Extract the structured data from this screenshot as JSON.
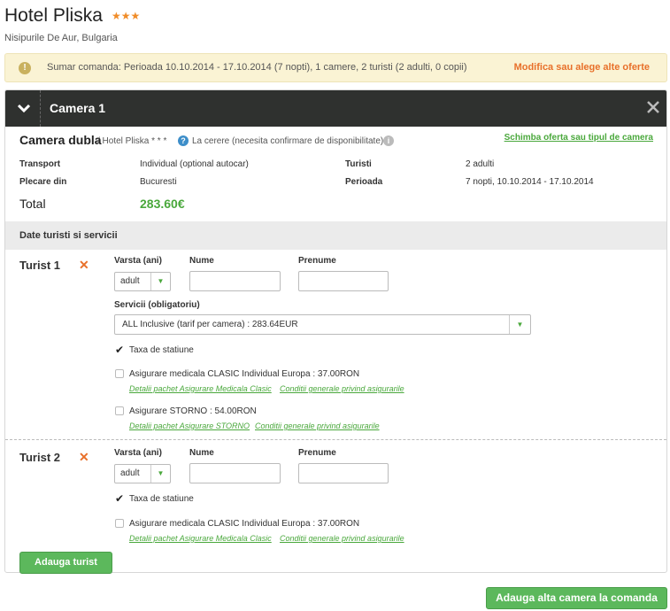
{
  "hotel": {
    "name": "Hotel Pliska",
    "stars": "★★★",
    "location": "Nisipurile De Aur, Bulgaria"
  },
  "summary": {
    "text": "Sumar comanda: Perioada 10.10.2014 - 17.10.2014 (7 nopti), 1 camere, 2 turisti (2 adulti, 0 copii)",
    "modify_link": "Modifica sau alege alte oferte"
  },
  "room": {
    "header_title": "Camera 1",
    "type": "Camera dubla",
    "subtitle": "/ Hotel Pliska * * *",
    "request_status": "La cerere (necesita confirmare de disponibilitate)",
    "change_link": "Schimba oferta sau tipul de camera",
    "details": {
      "transport_label": "Transport",
      "transport_value": "Individual (optional autocar)",
      "departure_label": "Plecare din",
      "departure_value": "Bucuresti",
      "tourists_label": "Turisti",
      "tourists_value": "2 adulti",
      "period_label": "Perioada",
      "period_value": "7 nopti, 10.10.2014 - 17.10.2014"
    },
    "total_label": "Total",
    "total_value": "283.60€",
    "section_title": "Date turisti si servicii"
  },
  "form_labels": {
    "age": "Varsta (ani)",
    "first_name": "Nume",
    "last_name": "Prenume",
    "services": "Servicii (obligatoriu)"
  },
  "tourists": [
    {
      "label": "Turist 1",
      "age": "adult",
      "service": "ALL Inclusive (tarif per camera) : 283.64EUR",
      "station_tax": "Taxa de statiune",
      "insurance_medical": "Asigurare medicala CLASIC Individual Europa : 37.00RON",
      "medical_details_link": "Detalii pachet Asigurare Medicala Clasic",
      "medical_conditions_link": "Conditii generale privind asigurarile",
      "insurance_storno": "Asigurare STORNO : 54.00RON",
      "storno_details_link": "Detalii pachet Asigurare STORNO",
      "storno_conditions_link": "Conditii generale privind asigurarile"
    },
    {
      "label": "Turist 2",
      "age": "adult",
      "station_tax": "Taxa de statiune",
      "insurance_medical": "Asigurare medicala CLASIC Individual Europa : 37.00RON",
      "medical_details_link": "Detalii pachet Asigurare Medicala Clasic",
      "medical_conditions_link": "Conditii generale privind asigurarile"
    }
  ],
  "buttons": {
    "add_tourist": "Adauga turist",
    "add_room": "Adauga alta camera la comanda"
  },
  "colors": {
    "accent_orange": "#e8702a",
    "accent_green": "#4aa83c",
    "header_dark": "#2f312f",
    "summary_bg": "#faf3d4"
  }
}
